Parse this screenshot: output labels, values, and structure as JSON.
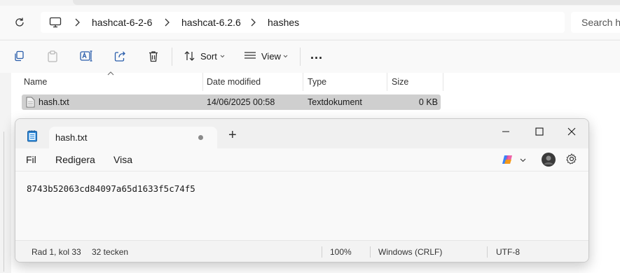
{
  "explorer": {
    "breadcrumb": [
      "hashcat-6-2-6",
      "hashcat-6.2.6",
      "hashes"
    ],
    "search_placeholder": "Search ha",
    "toolbar": {
      "sort_label": "Sort",
      "view_label": "View",
      "more_label": "..."
    },
    "columns": [
      "Name",
      "Date modified",
      "Type",
      "Size"
    ],
    "files": [
      {
        "name": "hash.txt",
        "date": "14/06/2025 00:58",
        "type": "Textdokument",
        "size": "0 KB"
      }
    ]
  },
  "notepad": {
    "tab_title": "hash.txt",
    "menu": [
      "Fil",
      "Redigera",
      "Visa"
    ],
    "content": "8743b52063cd84097a65d1633f5c74f5",
    "status": {
      "position": "Rad 1, kol 33",
      "chars": "32 tecken",
      "zoom": "100%",
      "line_ending": "Windows (CRLF)",
      "encoding": "UTF-8"
    }
  }
}
